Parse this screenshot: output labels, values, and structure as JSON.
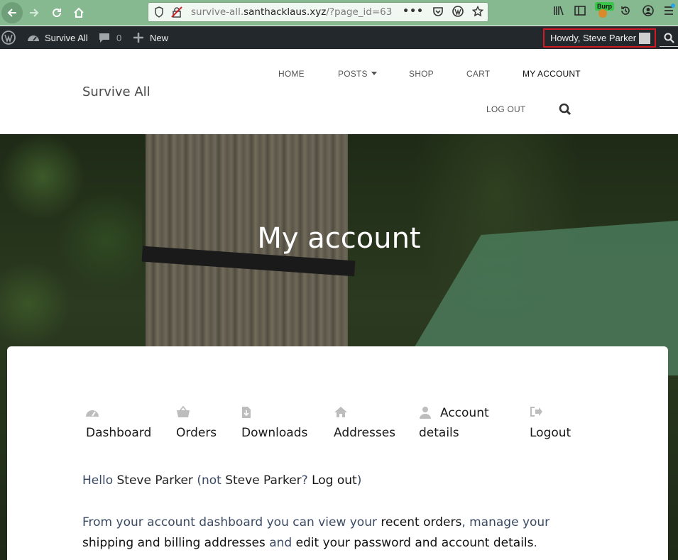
{
  "browser": {
    "url_prefix": "survive-all.",
    "url_domain": "santhacklaus.xyz",
    "url_path": "/?page_id=63",
    "burp_label": "Burp"
  },
  "adminbar": {
    "site_name": "Survive All",
    "comments_count": "0",
    "new_label": "New",
    "howdy": "Howdy, Steve Parker"
  },
  "header": {
    "site_title": "Survive All",
    "menu": {
      "home": "HOME",
      "posts": "POSTS",
      "shop": "SHOP",
      "cart": "CART",
      "my_account": "MY ACCOUNT",
      "log_out": "LOG OUT"
    }
  },
  "hero": {
    "title": "My account"
  },
  "account_nav": {
    "dashboard": "Dashboard",
    "orders": "Orders",
    "downloads": "Downloads",
    "addresses": "Addresses",
    "account_details_1": "Account",
    "account_details_2": "details",
    "logout": "Logout"
  },
  "greeting": {
    "hello": "Hello",
    "name": "Steve Parker",
    "not": "(not",
    "name2": "Steve Parker",
    "q": "?",
    "logout_link": "Log out",
    "close": ")"
  },
  "dashboard_text": {
    "part1": "From your account dashboard you can view your",
    "recent_orders": "recent orders",
    "part2": ", manage your",
    "addresses_link": "shipping and billing addresses",
    "part3": "and",
    "edit_link": "edit your password and account details",
    "part4": "."
  },
  "colors": {
    "browser_chrome": "#86b98f",
    "admin_bar": "#23282d",
    "highlight_border": "#d11b24",
    "text_blue": "#3b4a63"
  }
}
